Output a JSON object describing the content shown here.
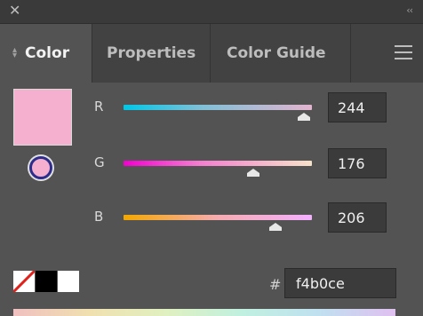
{
  "panel": {
    "close_icon": "close-icon",
    "collapse_icon": "double-chevron-left-icon",
    "tabs": [
      {
        "label": "Color",
        "active": true
      },
      {
        "label": "Properties",
        "active": false
      },
      {
        "label": "Color Guide",
        "active": false
      }
    ],
    "menu_icon": "hamburger-menu-icon"
  },
  "color": {
    "fill_swatch": "#f4b0ce",
    "channels": [
      {
        "label": "R",
        "value": "244",
        "fraction": 0.957
      },
      {
        "label": "G",
        "value": "176",
        "fraction": 0.69
      },
      {
        "label": "B",
        "value": "206",
        "fraction": 0.808
      }
    ],
    "hash_label": "#",
    "hex": "f4b0ce"
  },
  "quick_swatches": [
    "none",
    "black",
    "white"
  ]
}
